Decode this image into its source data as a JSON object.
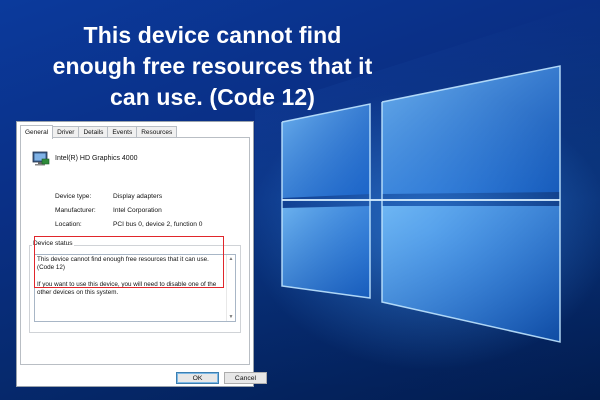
{
  "headline": {
    "line1": "This device cannot find",
    "line2": "enough free resources that it",
    "line3": "can use. (Code 12)"
  },
  "dialog": {
    "tabs": [
      {
        "label": "General",
        "active": true
      },
      {
        "label": "Driver"
      },
      {
        "label": "Details"
      },
      {
        "label": "Events"
      },
      {
        "label": "Resources"
      }
    ],
    "device_name": "Intel(R) HD Graphics 4000",
    "device_icon": "display-adapter-icon",
    "properties": {
      "device_type_label": "Device type:",
      "device_type_value": "Display adapters",
      "manufacturer_label": "Manufacturer:",
      "manufacturer_value": "Intel Corporation",
      "location_label": "Location:",
      "location_value": "PCI bus 0, device 2, function 0"
    },
    "status": {
      "legend": "Device status",
      "line1": "This device cannot find enough free resources that it can use. (Code 12)",
      "line2": "If you want to use this device, you will need to disable one of the other devices on this system."
    },
    "buttons": {
      "ok": "OK",
      "cancel": "Cancel"
    }
  },
  "colors": {
    "highlight": "#e0262b",
    "wallpaper": "#0b3a9c"
  }
}
